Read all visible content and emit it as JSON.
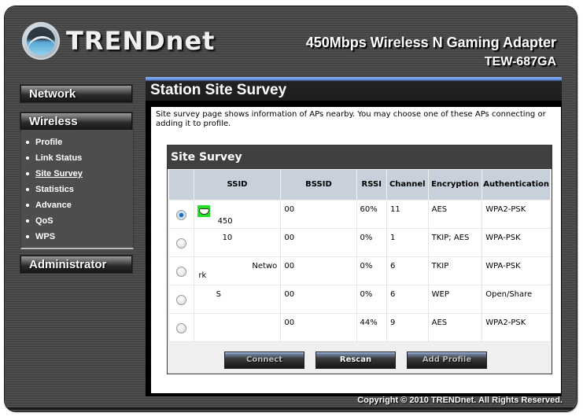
{
  "header": {
    "logo_text": "TRENDnet",
    "product_title": "450Mbps Wireless N Gaming Adapter",
    "model": "TEW-687GA"
  },
  "sidebar": {
    "network_label": "Network",
    "wireless_label": "Wireless",
    "wireless_items": [
      {
        "label": "Profile",
        "active": false
      },
      {
        "label": "Link Status",
        "active": false
      },
      {
        "label": "Site Survey",
        "active": true
      },
      {
        "label": "Statistics",
        "active": false
      },
      {
        "label": "Advance",
        "active": false
      },
      {
        "label": "QoS",
        "active": false
      },
      {
        "label": "WPS",
        "active": false
      }
    ],
    "administrator_label": "Administrator"
  },
  "main": {
    "page_title": "Station Site Survey",
    "description": "Site survey page shows information of APs nearby. You may choose one of these APs connecting or adding it to profile.",
    "survey": {
      "title": "Site Survey",
      "columns": [
        "",
        "SSID",
        "BSSID",
        "RSSI",
        "Channel",
        "Encryption",
        "Authentication"
      ],
      "rows": [
        {
          "selected": true,
          "connected_icon": "connected-handshake-icon",
          "ssid": "450",
          "bssid": "00",
          "rssi": "60%",
          "channel": "11",
          "encryption": "AES",
          "authentication": "WPA2-PSK"
        },
        {
          "selected": false,
          "connected_icon": "",
          "ssid": "10",
          "bssid": "00",
          "rssi": "0%",
          "channel": "1",
          "encryption": "TKIP; AES",
          "authentication": "WPA-PSK"
        },
        {
          "selected": false,
          "connected_icon": "",
          "ssid": "Network",
          "bssid": "00",
          "rssi": "0%",
          "channel": "6",
          "encryption": "TKIP",
          "authentication": "WPA-PSK"
        },
        {
          "selected": false,
          "connected_icon": "",
          "ssid": "S",
          "bssid": "00",
          "rssi": "0%",
          "channel": "6",
          "encryption": "WEP",
          "authentication": "Open/Share"
        },
        {
          "selected": false,
          "connected_icon": "",
          "ssid": "",
          "bssid": "00",
          "rssi": "44%",
          "channel": "9",
          "encryption": "AES",
          "authentication": "WPA2-PSK"
        }
      ],
      "buttons": {
        "connect": "Connect",
        "rescan": "Rescan",
        "add_profile": "Add Profile"
      }
    }
  },
  "footer": {
    "copyright": "Copyright © 2010 TRENDnet. All Rights Reserved."
  }
}
